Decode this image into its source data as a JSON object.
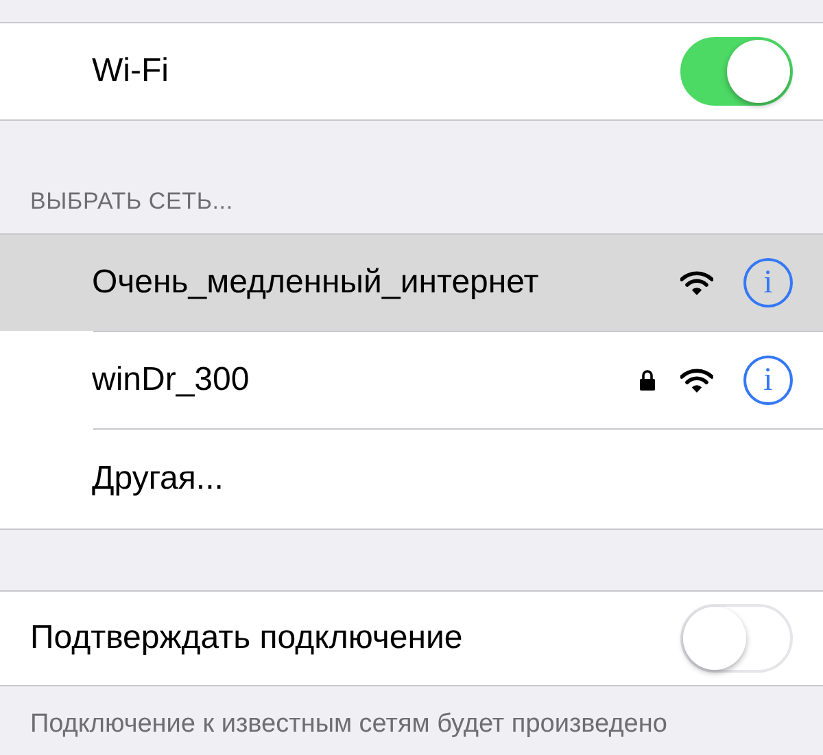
{
  "wifi": {
    "label": "Wi-Fi",
    "on": true
  },
  "networks_header": "ВЫБРАТЬ СЕТЬ...",
  "networks": [
    {
      "kind": "network",
      "name": "Очень_медленный_интернет",
      "selected": true,
      "locked": false,
      "info": "i"
    },
    {
      "kind": "network",
      "name": "winDr_300",
      "selected": false,
      "locked": true,
      "info": "i"
    },
    {
      "kind": "other",
      "name": "Другая...",
      "selected": false
    }
  ],
  "ask_to_join": {
    "label": "Подтверждать подключение",
    "on": false
  },
  "footer": "Подключение к известным сетям будет произведено"
}
